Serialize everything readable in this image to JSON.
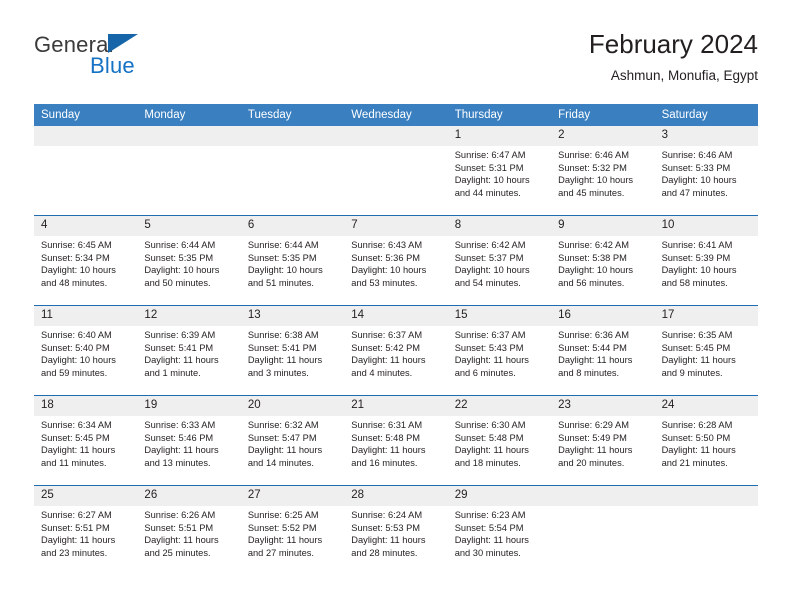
{
  "brand": {
    "name_top": "General",
    "name_bottom": "Blue",
    "triangle_color": "#1565a8",
    "blue_color": "#1572c4"
  },
  "header": {
    "title": "February 2024",
    "subtitle": "Ashmun, Monufia, Egypt"
  },
  "colors": {
    "header_row_bg": "#3a7fc0",
    "header_row_text": "#ffffff",
    "week_separator": "#1f6cb0",
    "daynum_bg": "#efefef",
    "body_text": "#231f20"
  },
  "weekdays": [
    "Sunday",
    "Monday",
    "Tuesday",
    "Wednesday",
    "Thursday",
    "Friday",
    "Saturday"
  ],
  "weeks": [
    [
      {
        "day": "",
        "lines": []
      },
      {
        "day": "",
        "lines": []
      },
      {
        "day": "",
        "lines": []
      },
      {
        "day": "",
        "lines": []
      },
      {
        "day": "1",
        "lines": [
          "Sunrise: 6:47 AM",
          "Sunset: 5:31 PM",
          "Daylight: 10 hours",
          "and 44 minutes."
        ]
      },
      {
        "day": "2",
        "lines": [
          "Sunrise: 6:46 AM",
          "Sunset: 5:32 PM",
          "Daylight: 10 hours",
          "and 45 minutes."
        ]
      },
      {
        "day": "3",
        "lines": [
          "Sunrise: 6:46 AM",
          "Sunset: 5:33 PM",
          "Daylight: 10 hours",
          "and 47 minutes."
        ]
      }
    ],
    [
      {
        "day": "4",
        "lines": [
          "Sunrise: 6:45 AM",
          "Sunset: 5:34 PM",
          "Daylight: 10 hours",
          "and 48 minutes."
        ]
      },
      {
        "day": "5",
        "lines": [
          "Sunrise: 6:44 AM",
          "Sunset: 5:35 PM",
          "Daylight: 10 hours",
          "and 50 minutes."
        ]
      },
      {
        "day": "6",
        "lines": [
          "Sunrise: 6:44 AM",
          "Sunset: 5:35 PM",
          "Daylight: 10 hours",
          "and 51 minutes."
        ]
      },
      {
        "day": "7",
        "lines": [
          "Sunrise: 6:43 AM",
          "Sunset: 5:36 PM",
          "Daylight: 10 hours",
          "and 53 minutes."
        ]
      },
      {
        "day": "8",
        "lines": [
          "Sunrise: 6:42 AM",
          "Sunset: 5:37 PM",
          "Daylight: 10 hours",
          "and 54 minutes."
        ]
      },
      {
        "day": "9",
        "lines": [
          "Sunrise: 6:42 AM",
          "Sunset: 5:38 PM",
          "Daylight: 10 hours",
          "and 56 minutes."
        ]
      },
      {
        "day": "10",
        "lines": [
          "Sunrise: 6:41 AM",
          "Sunset: 5:39 PM",
          "Daylight: 10 hours",
          "and 58 minutes."
        ]
      }
    ],
    [
      {
        "day": "11",
        "lines": [
          "Sunrise: 6:40 AM",
          "Sunset: 5:40 PM",
          "Daylight: 10 hours",
          "and 59 minutes."
        ]
      },
      {
        "day": "12",
        "lines": [
          "Sunrise: 6:39 AM",
          "Sunset: 5:41 PM",
          "Daylight: 11 hours",
          "and 1 minute."
        ]
      },
      {
        "day": "13",
        "lines": [
          "Sunrise: 6:38 AM",
          "Sunset: 5:41 PM",
          "Daylight: 11 hours",
          "and 3 minutes."
        ]
      },
      {
        "day": "14",
        "lines": [
          "Sunrise: 6:37 AM",
          "Sunset: 5:42 PM",
          "Daylight: 11 hours",
          "and 4 minutes."
        ]
      },
      {
        "day": "15",
        "lines": [
          "Sunrise: 6:37 AM",
          "Sunset: 5:43 PM",
          "Daylight: 11 hours",
          "and 6 minutes."
        ]
      },
      {
        "day": "16",
        "lines": [
          "Sunrise: 6:36 AM",
          "Sunset: 5:44 PM",
          "Daylight: 11 hours",
          "and 8 minutes."
        ]
      },
      {
        "day": "17",
        "lines": [
          "Sunrise: 6:35 AM",
          "Sunset: 5:45 PM",
          "Daylight: 11 hours",
          "and 9 minutes."
        ]
      }
    ],
    [
      {
        "day": "18",
        "lines": [
          "Sunrise: 6:34 AM",
          "Sunset: 5:45 PM",
          "Daylight: 11 hours",
          "and 11 minutes."
        ]
      },
      {
        "day": "19",
        "lines": [
          "Sunrise: 6:33 AM",
          "Sunset: 5:46 PM",
          "Daylight: 11 hours",
          "and 13 minutes."
        ]
      },
      {
        "day": "20",
        "lines": [
          "Sunrise: 6:32 AM",
          "Sunset: 5:47 PM",
          "Daylight: 11 hours",
          "and 14 minutes."
        ]
      },
      {
        "day": "21",
        "lines": [
          "Sunrise: 6:31 AM",
          "Sunset: 5:48 PM",
          "Daylight: 11 hours",
          "and 16 minutes."
        ]
      },
      {
        "day": "22",
        "lines": [
          "Sunrise: 6:30 AM",
          "Sunset: 5:48 PM",
          "Daylight: 11 hours",
          "and 18 minutes."
        ]
      },
      {
        "day": "23",
        "lines": [
          "Sunrise: 6:29 AM",
          "Sunset: 5:49 PM",
          "Daylight: 11 hours",
          "and 20 minutes."
        ]
      },
      {
        "day": "24",
        "lines": [
          "Sunrise: 6:28 AM",
          "Sunset: 5:50 PM",
          "Daylight: 11 hours",
          "and 21 minutes."
        ]
      }
    ],
    [
      {
        "day": "25",
        "lines": [
          "Sunrise: 6:27 AM",
          "Sunset: 5:51 PM",
          "Daylight: 11 hours",
          "and 23 minutes."
        ]
      },
      {
        "day": "26",
        "lines": [
          "Sunrise: 6:26 AM",
          "Sunset: 5:51 PM",
          "Daylight: 11 hours",
          "and 25 minutes."
        ]
      },
      {
        "day": "27",
        "lines": [
          "Sunrise: 6:25 AM",
          "Sunset: 5:52 PM",
          "Daylight: 11 hours",
          "and 27 minutes."
        ]
      },
      {
        "day": "28",
        "lines": [
          "Sunrise: 6:24 AM",
          "Sunset: 5:53 PM",
          "Daylight: 11 hours",
          "and 28 minutes."
        ]
      },
      {
        "day": "29",
        "lines": [
          "Sunrise: 6:23 AM",
          "Sunset: 5:54 PM",
          "Daylight: 11 hours",
          "and 30 minutes."
        ]
      },
      {
        "day": "",
        "lines": []
      },
      {
        "day": "",
        "lines": []
      }
    ]
  ]
}
